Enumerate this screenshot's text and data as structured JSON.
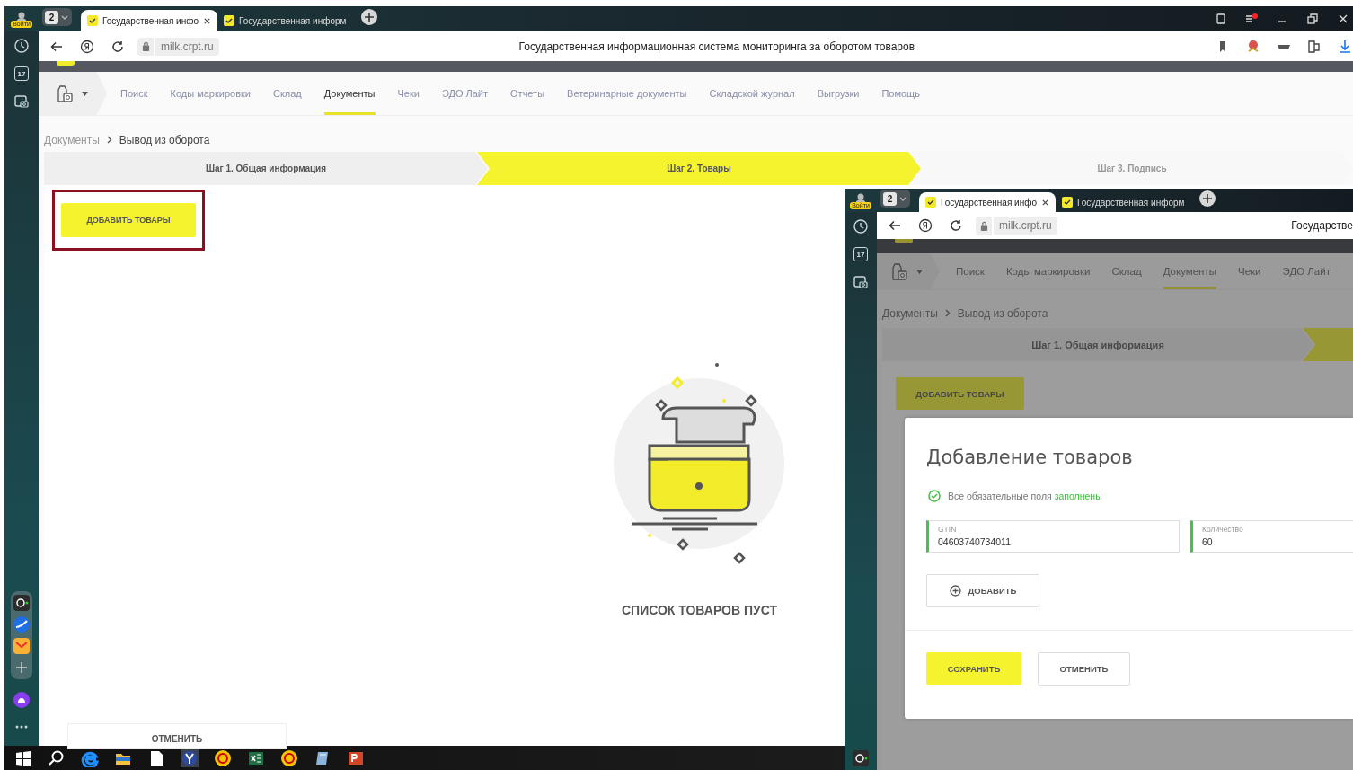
{
  "main": {
    "browser": {
      "profile_label": "Войти",
      "tab_count": "2",
      "tabs": [
        {
          "title": "Государственная инфо",
          "selected": true
        },
        {
          "title": "Государственная информ",
          "selected": false
        }
      ],
      "url": "milk.crpt.ru",
      "page_title": "Государственная информационная система мониторинга за оборотом товаров"
    },
    "sidebar": {
      "calendar_day": "17"
    },
    "page": {
      "nav": [
        {
          "label": "Поиск",
          "selected": false
        },
        {
          "label": "Коды маркировки",
          "selected": false
        },
        {
          "label": "Склад",
          "selected": false
        },
        {
          "label": "Документы",
          "selected": true
        },
        {
          "label": "Чеки",
          "selected": false
        },
        {
          "label": "ЭДО Лайт",
          "selected": false
        },
        {
          "label": "Отчеты",
          "selected": false
        },
        {
          "label": "Ветеринарные документы",
          "selected": false
        },
        {
          "label": "Складской журнал",
          "selected": false
        },
        {
          "label": "Выгрузки",
          "selected": false
        },
        {
          "label": "Помощь",
          "selected": false
        }
      ],
      "breadcrumb": [
        "Документы",
        "Вывод из оборота"
      ],
      "steps": [
        {
          "label": "Шаг 1. Общая информация",
          "selected": false,
          "completed": true
        },
        {
          "label": "Шаг 2. Товары",
          "selected": true
        },
        {
          "label": "Шаг 3. Подпись",
          "selected": false,
          "completed": false
        }
      ],
      "add_button": {
        "label": "ДОБАВИТЬ ТОВАРЫ",
        "highlighted": true
      },
      "empty_text": "СПИСОК ТОВАРОВ ПУСТ",
      "cancel_button": "ОТМЕНИТЬ"
    }
  },
  "inset": {
    "browser": {
      "profile_label": "Войти",
      "tab_count": "2",
      "tabs": [
        {
          "title": "Государственная инфо",
          "selected": true
        },
        {
          "title": "Государственная информ",
          "selected": false
        }
      ],
      "url": "milk.crpt.ru",
      "page_title": "Государстве"
    },
    "sidebar": {
      "calendar_day": "17"
    },
    "page": {
      "nav": [
        {
          "label": "Поиск",
          "selected": false
        },
        {
          "label": "Коды маркировки",
          "selected": false
        },
        {
          "label": "Склад",
          "selected": false
        },
        {
          "label": "Документы",
          "selected": true
        },
        {
          "label": "Чеки",
          "selected": false
        },
        {
          "label": "ЭДО Лайт",
          "selected": false
        }
      ],
      "breadcrumb": [
        "Документы",
        "Вывод из оборота"
      ],
      "steps": [
        {
          "label": "Шаг 1. Общая информация",
          "selected": false,
          "completed": true
        },
        {
          "selected": true
        }
      ],
      "add_button": {
        "label": "ДОБАВИТЬ ТОВАРЫ"
      }
    },
    "modal": {
      "title": "Добавление товаров",
      "status_text": "Все обязательные поля",
      "status_highlight": "заполнены",
      "fields": [
        {
          "label": "GTIN",
          "value": "04603740734011"
        },
        {
          "label": "Количество",
          "value": "60"
        }
      ],
      "add_row_button": "ДОБАВИТЬ",
      "save_button": "СОХРАНИТЬ",
      "cancel_button": "ОТМЕНИТЬ"
    }
  }
}
